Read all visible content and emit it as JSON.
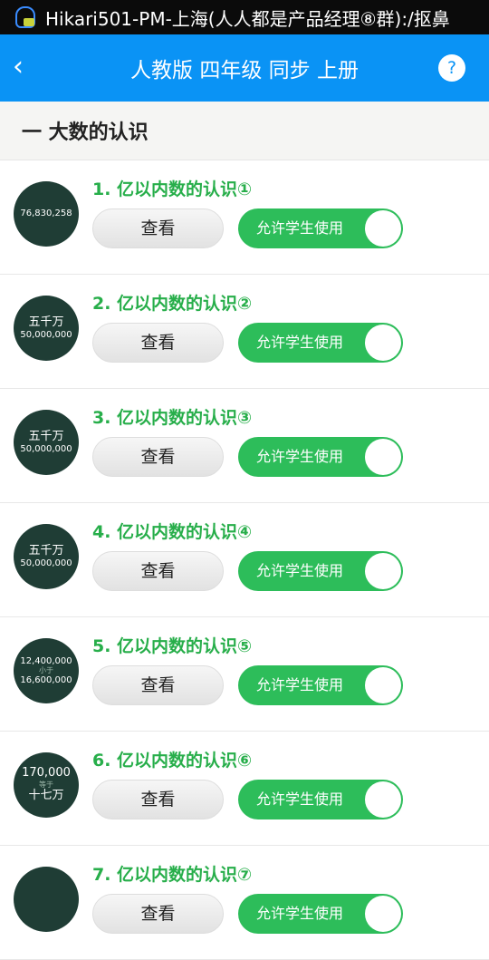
{
  "status": {
    "notification": "Hikari501-PM-上海(人人都是产品经理⑧群):/抠鼻"
  },
  "nav": {
    "back": "‹",
    "title": "人教版 四年级 同步 上册",
    "help": "?"
  },
  "section": {
    "title": "一 大数的认识"
  },
  "lessons": [
    {
      "name": "1. 亿以内数的认识①",
      "thumb": [
        "76,830,258",
        "",
        ""
      ],
      "view": "查看",
      "toggle": "允许学生使用",
      "enabled": true
    },
    {
      "name": "2. 亿以内数的认识②",
      "thumb": [
        "五千万",
        "",
        "50,000,000"
      ],
      "view": "查看",
      "toggle": "允许学生使用",
      "enabled": true
    },
    {
      "name": "3. 亿以内数的认识③",
      "thumb": [
        "五千万",
        "",
        "50,000,000"
      ],
      "view": "查看",
      "toggle": "允许学生使用",
      "enabled": true
    },
    {
      "name": "4. 亿以内数的认识④",
      "thumb": [
        "五千万",
        "",
        "50,000,000"
      ],
      "view": "查看",
      "toggle": "允许学生使用",
      "enabled": true
    },
    {
      "name": "5. 亿以内数的认识⑤",
      "thumb": [
        "12,400,000",
        "小于",
        "16,600,000"
      ],
      "view": "查看",
      "toggle": "允许学生使用",
      "enabled": true
    },
    {
      "name": "6. 亿以内数的认识⑥",
      "thumb": [
        "170,000",
        "等于",
        "十七万"
      ],
      "view": "查看",
      "toggle": "允许学生使用",
      "enabled": true
    },
    {
      "name": "7. 亿以内数的认识⑦",
      "thumb": [
        "",
        "",
        ""
      ],
      "view": "查看",
      "toggle": "允许学生使用",
      "enabled": true
    }
  ],
  "colors": {
    "nav": "#0a93f5",
    "accent": "#27ae4a",
    "toggle": "#2dbd5a"
  }
}
